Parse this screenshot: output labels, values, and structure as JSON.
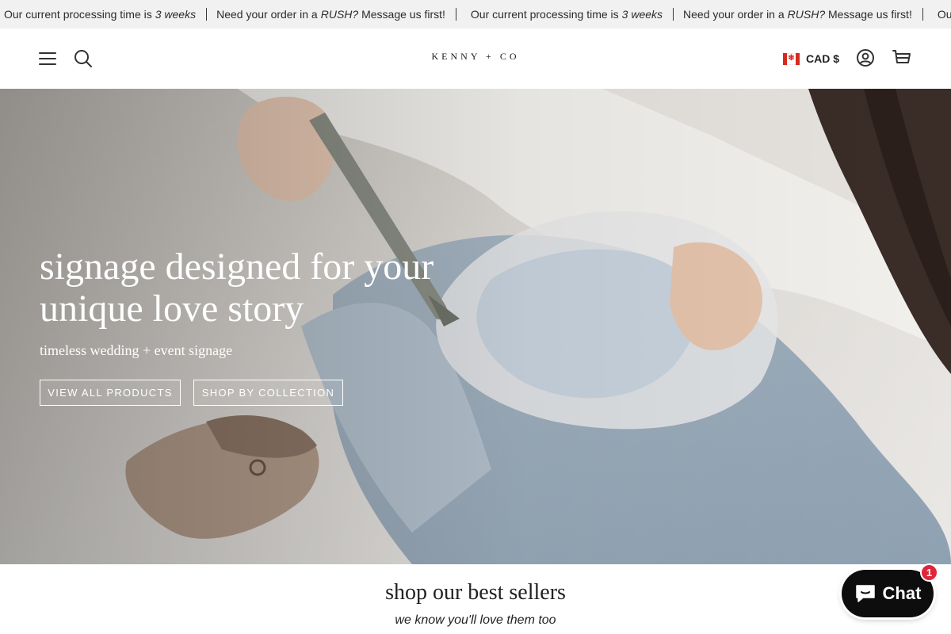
{
  "announcement": {
    "items": [
      {
        "text": "Our current processing time is",
        "em": "3 weeks"
      },
      {
        "text": "Need your order in a",
        "em": "RUSH?",
        "tail": "Message us first!"
      },
      {
        "text": "Our current processing time is",
        "em": "3 weeks"
      },
      {
        "text": "Need your order in a",
        "em": "RUSH?",
        "tail": "Message us first!"
      },
      {
        "text": "Our"
      }
    ]
  },
  "header": {
    "logo": "KENNY + CO",
    "currency": "CAD $",
    "icons": [
      "menu-icon",
      "search-icon",
      "canada-flag-icon",
      "account-icon",
      "cart-icon"
    ]
  },
  "hero": {
    "title_line1": "signage designed for your",
    "title_line2": "unique love story",
    "subtitle": "timeless wedding + event signage",
    "buttons": [
      "VIEW ALL PRODUCTS",
      "SHOP BY COLLECTION"
    ]
  },
  "best_sellers": {
    "title": "shop our best sellers",
    "subtitle": "we know you'll love them too"
  },
  "chat": {
    "label": "Chat",
    "badge": "1"
  },
  "colors": {
    "announcement_bg": "#f1f1f1",
    "chat_bg": "#0d0d0d",
    "badge": "#e0253a"
  }
}
